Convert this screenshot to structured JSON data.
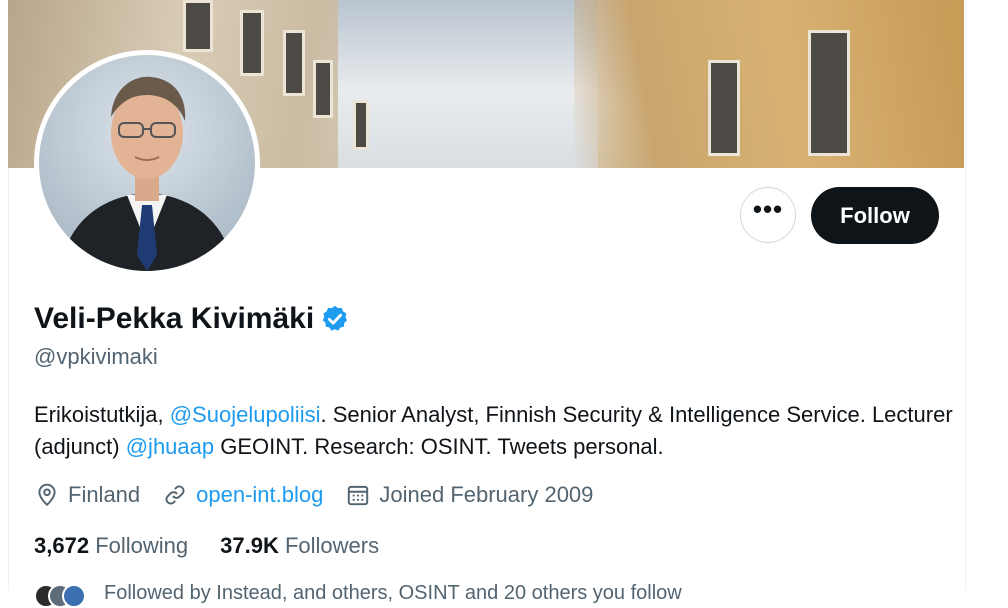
{
  "profile": {
    "display_name": "Veli-Pekka Kivimäki",
    "handle": "@vpkivimaki",
    "verified_icon": "verified-badge-icon",
    "verified_color": "#1d9bf0",
    "bio": {
      "part1": "Erikoistutkija, ",
      "mention1": "@Suojelupoliisi",
      "part2": ". Senior Analyst, Finnish Security & Intelligence Service. Lecturer (adjunct) ",
      "mention2": "@jhuaap",
      "part3": " GEOINT. Research: OSINT. Tweets personal."
    },
    "location": "Finland",
    "website": "open-int.blog",
    "joined": "Joined February 2009"
  },
  "actions": {
    "more_label": "•••",
    "follow_label": "Follow"
  },
  "stats": {
    "following_count": "3,672",
    "following_label": "Following",
    "followers_count": "37.9K",
    "followers_label": "Followers"
  },
  "followed_by": {
    "text": "Followed by Instead, and others, OSINT and 20 others you follow"
  },
  "colors": {
    "accent": "#1d9bf0",
    "follow_button_bg": "#0f1419",
    "secondary_text": "#536471"
  }
}
